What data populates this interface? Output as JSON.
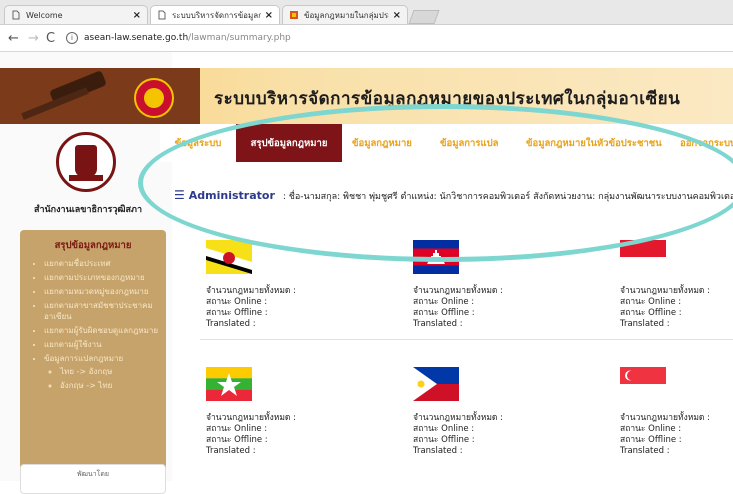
{
  "browser": {
    "tabs": [
      {
        "title": "Welcome"
      },
      {
        "title": "ระบบบริหารจัดการข้อมูลกฎ"
      },
      {
        "title": "ข้อมูลกฎหมายในกลุ่มประเท"
      }
    ],
    "url_host": "asean-law.senate.go.th",
    "url_path": "/lawman/summary.php"
  },
  "header": {
    "site_title": "ระบบบริหารจัดการข้อมูลกฎหมายของประเทศในกลุ่มอาเซียน",
    "office_name": "สำนักงานเลขาธิการวุฒิสภา"
  },
  "nav": [
    {
      "label": "ข้อมูลระบบ"
    },
    {
      "label": "สรุปข้อมูลกฎหมาย"
    },
    {
      "label": "ข้อมูลกฎหมาย"
    },
    {
      "label": "ข้อมูลการแปล"
    },
    {
      "label": "ข้อมูลกฎหมายในหัวข้อประชาชน"
    },
    {
      "label": "ออกจากระบบ"
    }
  ],
  "admin": {
    "title": "Administrator",
    "text": ": ชื่อ-นามสกุล: พิชชา พุ่มชูศรี  ตำแหน่ง: นักวิชาการคอมพิวเตอร์  สังกัดหน่วยงาน: กลุ่มงานพัฒนาระบบงานคอมพิวเตอร์"
  },
  "sidebar": {
    "title": "สรุปข้อมูลกฎหมาย",
    "items": [
      "แยกตามชื่อประเทศ",
      "แยกตามประเภทของกฎหมาย",
      "แยกตามหมวดหมู่ของกฎหมาย",
      "แยกตามสาขาสมัชชาประชาคมอาเซียน",
      "แยกตามผู้รับผิดชอบดูแลกฎหมาย",
      "แยกตามผู้ใช้งาน",
      "ข้อมูลการแปลกฎหมาย"
    ],
    "subitems": [
      "ไทย -> อังกฤษ",
      "อังกฤษ -> ไทย"
    ],
    "footer": "พัฒนาโดย"
  },
  "stat_labels": {
    "total": "จำนวนกฎหมายทั้งหมด :",
    "online": "สถานะ Online :",
    "offline": "สถานะ Offline :",
    "translated": "Translated :"
  },
  "countries": [
    {
      "flag": "brunei-flag-icon"
    },
    {
      "flag": "cambodia-flag-icon"
    },
    {
      "flag": "indonesia-flag-icon"
    },
    {
      "flag": "myanmar-flag-icon"
    },
    {
      "flag": "philippines-flag-icon"
    },
    {
      "flag": "singapore-flag-icon"
    }
  ],
  "colors": {
    "nav_active": "#7e1418",
    "nav_text": "#e8a21a",
    "sidebar_bg": "#c6a36b",
    "highlight_ellipse": "#7dd6cf"
  }
}
